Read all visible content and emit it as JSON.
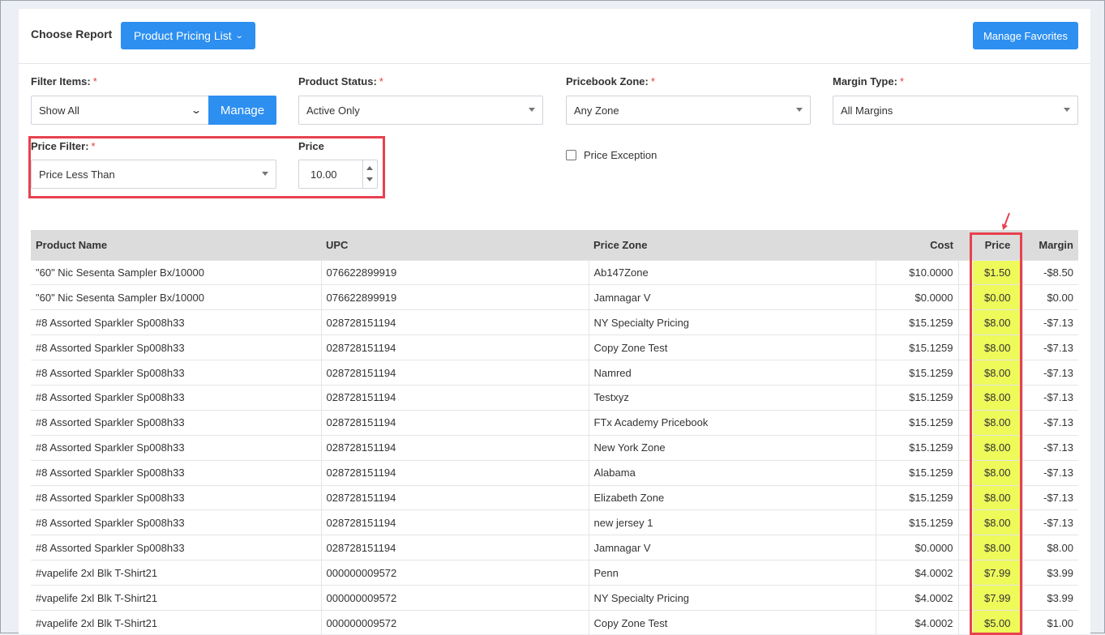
{
  "header": {
    "choose_report_label": "Choose Report",
    "report_button_label": "Product Pricing List",
    "manage_favorites_label": "Manage Favorites"
  },
  "filters": {
    "filter_items": {
      "label": "Filter Items:",
      "required": "*",
      "value": "Show All",
      "manage_label": "Manage"
    },
    "product_status": {
      "label": "Product Status:",
      "required": "*",
      "value": "Active Only"
    },
    "pricebook_zone": {
      "label": "Pricebook Zone:",
      "required": "*",
      "value": "Any Zone"
    },
    "margin_type": {
      "label": "Margin Type:",
      "required": "*",
      "value": "All Margins"
    },
    "price_filter": {
      "label": "Price Filter:",
      "required": "*",
      "value": "Price Less Than"
    },
    "price": {
      "label": "Price",
      "value": "10.00"
    },
    "price_exception": {
      "label": "Price Exception",
      "checked": false
    }
  },
  "table": {
    "columns": [
      "Product Name",
      "UPC",
      "Price Zone",
      "Cost",
      "Price",
      "Margin"
    ],
    "rows": [
      {
        "name": "\"60\" Nic Sesenta Sampler Bx/10000",
        "upc": "076622899919",
        "zone": "Ab147Zone",
        "cost": "$10.0000",
        "price": "$1.50",
        "margin": "-$8.50"
      },
      {
        "name": "\"60\" Nic Sesenta Sampler Bx/10000",
        "upc": "076622899919",
        "zone": "Jamnagar V",
        "cost": "$0.0000",
        "price": "$0.00",
        "margin": "$0.00"
      },
      {
        "name": "#8 Assorted Sparkler Sp008h33",
        "upc": "028728151194",
        "zone": "NY Specialty Pricing",
        "cost": "$15.1259",
        "price": "$8.00",
        "margin": "-$7.13"
      },
      {
        "name": "#8 Assorted Sparkler Sp008h33",
        "upc": "028728151194",
        "zone": "Copy Zone Test",
        "cost": "$15.1259",
        "price": "$8.00",
        "margin": "-$7.13"
      },
      {
        "name": "#8 Assorted Sparkler Sp008h33",
        "upc": "028728151194",
        "zone": "Namred",
        "cost": "$15.1259",
        "price": "$8.00",
        "margin": "-$7.13"
      },
      {
        "name": "#8 Assorted Sparkler Sp008h33",
        "upc": "028728151194",
        "zone": "Testxyz",
        "cost": "$15.1259",
        "price": "$8.00",
        "margin": "-$7.13"
      },
      {
        "name": "#8 Assorted Sparkler Sp008h33",
        "upc": "028728151194",
        "zone": "FTx Academy Pricebook",
        "cost": "$15.1259",
        "price": "$8.00",
        "margin": "-$7.13"
      },
      {
        "name": "#8 Assorted Sparkler Sp008h33",
        "upc": "028728151194",
        "zone": "New York Zone",
        "cost": "$15.1259",
        "price": "$8.00",
        "margin": "-$7.13"
      },
      {
        "name": "#8 Assorted Sparkler Sp008h33",
        "upc": "028728151194",
        "zone": "Alabama",
        "cost": "$15.1259",
        "price": "$8.00",
        "margin": "-$7.13"
      },
      {
        "name": "#8 Assorted Sparkler Sp008h33",
        "upc": "028728151194",
        "zone": "Elizabeth Zone",
        "cost": "$15.1259",
        "price": "$8.00",
        "margin": "-$7.13"
      },
      {
        "name": "#8 Assorted Sparkler Sp008h33",
        "upc": "028728151194",
        "zone": "new jersey 1",
        "cost": "$15.1259",
        "price": "$8.00",
        "margin": "-$7.13"
      },
      {
        "name": "#8 Assorted Sparkler Sp008h33",
        "upc": "028728151194",
        "zone": "Jamnagar V",
        "cost": "$0.0000",
        "price": "$8.00",
        "margin": "$8.00"
      },
      {
        "name": "#vapelife 2xl Blk T-Shirt21",
        "upc": "000000009572",
        "zone": "Penn",
        "cost": "$4.0002",
        "price": "$7.99",
        "margin": "$3.99"
      },
      {
        "name": "#vapelife 2xl Blk T-Shirt21",
        "upc": "000000009572",
        "zone": "NY Specialty Pricing",
        "cost": "$4.0002",
        "price": "$7.99",
        "margin": "$3.99"
      },
      {
        "name": "#vapelife 2xl Blk T-Shirt21",
        "upc": "000000009572",
        "zone": "Copy Zone Test",
        "cost": "$4.0002",
        "price": "$5.00",
        "margin": "$1.00"
      }
    ]
  },
  "colors": {
    "primary_button": "#2d8ff0",
    "highlight_annotation": "#e8414f",
    "price_highlight": "#eef95a",
    "required_asterisk": "#e23b3b"
  }
}
